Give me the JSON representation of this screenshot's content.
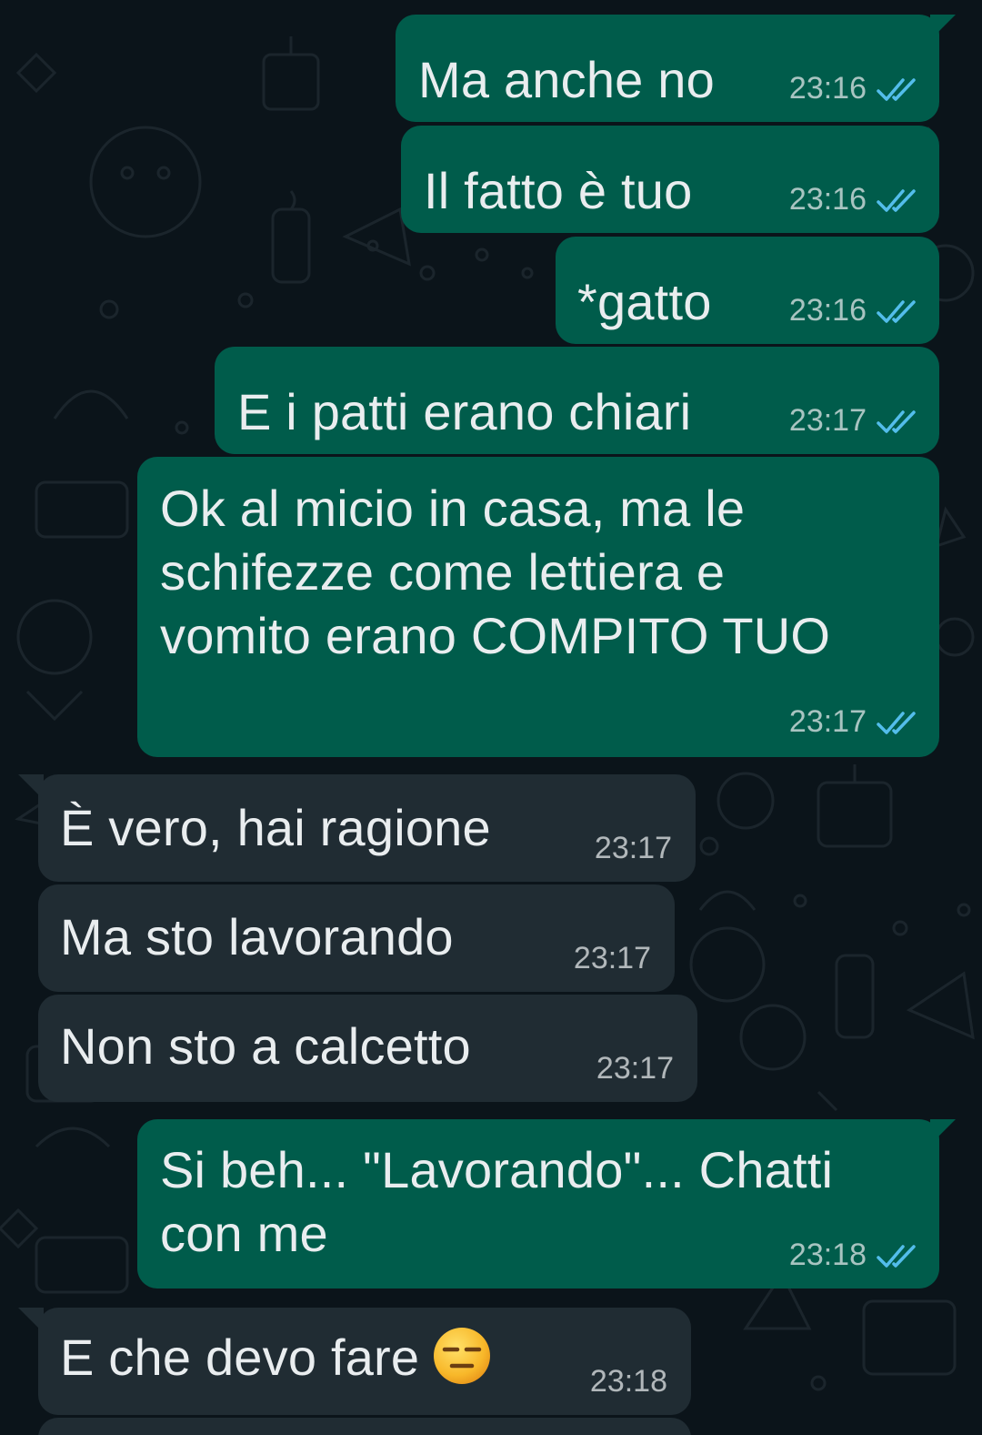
{
  "colors": {
    "background": "#0b141a",
    "outgoing_bubble": "#005c4b",
    "incoming_bubble": "#202c33",
    "text": "#e9edef",
    "read_ticks": "#53bdeb"
  },
  "messages": [
    {
      "direction": "out",
      "text": "Ma anche no",
      "time": "23:16",
      "status": "read"
    },
    {
      "direction": "out",
      "text": "Il fatto è tuo",
      "time": "23:16",
      "status": "read"
    },
    {
      "direction": "out",
      "text": "*gatto",
      "time": "23:16",
      "status": "read"
    },
    {
      "direction": "out",
      "text": "E i patti erano chiari",
      "time": "23:17",
      "status": "read"
    },
    {
      "direction": "out",
      "lines": [
        "Ok al micio in casa, ma le",
        "schifezze come lettiera e",
        "vomito erano COMPITO TUO"
      ],
      "time": "23:17",
      "status": "read"
    },
    {
      "direction": "in",
      "text": "È vero, hai ragione",
      "time": "23:17"
    },
    {
      "direction": "in",
      "text": "Ma sto lavorando",
      "time": "23:17"
    },
    {
      "direction": "in",
      "text": "Non sto a calcetto",
      "time": "23:17"
    },
    {
      "direction": "out",
      "lines": [
        "Si beh... \"Lavorando\"... Chatti",
        "con me"
      ],
      "time": "23:18",
      "status": "read"
    },
    {
      "direction": "in",
      "text": "E che devo fare",
      "emoji": "expressionless-face-emoji",
      "time": "23:18"
    }
  ]
}
